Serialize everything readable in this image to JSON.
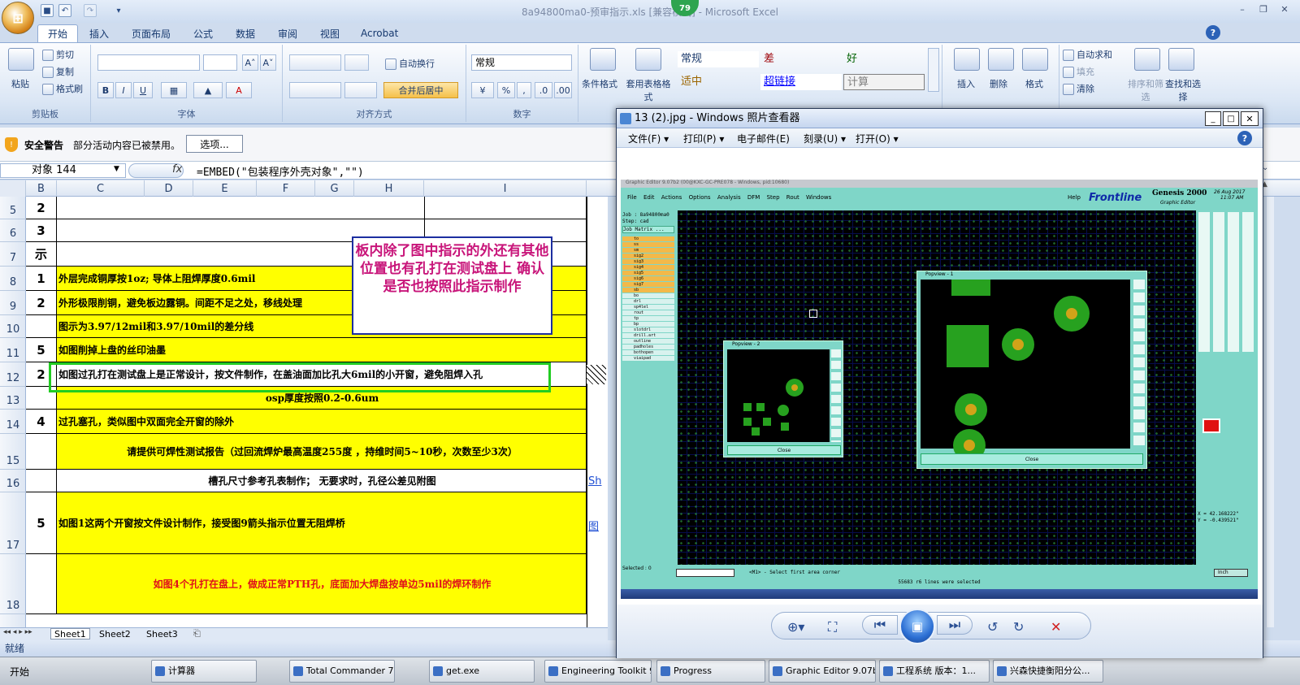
{
  "app": {
    "office_button": "⊞",
    "window_title": "8a94800ma0-预审指示.xls  [兼容模式] - Microsoft Excel",
    "badge": "79"
  },
  "ribbon": {
    "tabs": [
      "开始",
      "插入",
      "页面布局",
      "公式",
      "数据",
      "审阅",
      "视图",
      "Acrobat"
    ],
    "active_tab": "开始",
    "clipboard": {
      "paste": "粘贴",
      "cut": "剪切",
      "copy": "复制",
      "format_painter": "格式刷",
      "label": "剪贴板"
    },
    "font": {
      "label": "字体",
      "bold": "B",
      "italic": "I",
      "underline": "U",
      "grow": "A˄",
      "shrink": "A˅"
    },
    "alignment": {
      "label": "对齐方式",
      "wrap": "自动换行",
      "merge": "合并后居中"
    },
    "number": {
      "label": "数字",
      "format": "常规",
      "percent": "%",
      "comma": ","
    },
    "styles": {
      "conditional": "条件格式",
      "table_format": "套用表格格式",
      "normal": "常规",
      "bad": "差",
      "good": "好",
      "neutral": "适中",
      "hyperlink": "超链接",
      "calc": "计算"
    },
    "cells": {
      "insert": "插入",
      "delete": "删除",
      "format": "格式"
    },
    "editing": {
      "autosum": "自动求和",
      "fill": "填充",
      "clear": "清除",
      "sort": "排序和筛选",
      "find": "查找和选择"
    }
  },
  "security": {
    "title": "安全警告",
    "message": "部分活动内容已被禁用。",
    "options": "选项..."
  },
  "formula_bar": {
    "name_box": "对象 144",
    "fx": "fx",
    "formula": "=EMBED(\"包装程序外壳对象\",\"\")"
  },
  "columns": [
    "B",
    "C",
    "D",
    "E",
    "F",
    "G",
    "H",
    "I"
  ],
  "extra_column": "T",
  "rows": [
    {
      "row": "5",
      "num": "2",
      "text": "",
      "yellow": false
    },
    {
      "row": "6",
      "num": "3",
      "text": "",
      "yellow": false
    },
    {
      "row": "7",
      "num": "示",
      "text": "",
      "yellow": false
    },
    {
      "row": "8",
      "num": "1",
      "text": "外层完成铜厚按1oz;  导体上阻焊厚度0.6mil",
      "yellow": true
    },
    {
      "row": "9",
      "num": "2",
      "text": "外形极限削铜，避免板边露铜。间距不足之处，移线处理",
      "yellow": true
    },
    {
      "row": "10",
      "num": "",
      "text": "图示为3.97/12mil和3.97/10mil的差分线",
      "yellow": true
    },
    {
      "row": "11",
      "num": "5",
      "text": "如图削掉上盘的丝印油墨",
      "yellow": true
    },
    {
      "row": "12",
      "num": "2",
      "text": "如图过孔打在测试盘上是正常设计，按文件制作，在盖油面加比孔大6mil的小开窗，避免阻焊入孔",
      "yellow": false
    },
    {
      "row": "13",
      "num": "",
      "text": "osp厚度按照0.2-0.6um",
      "yellow": true
    },
    {
      "row": "14",
      "num": "4",
      "text": "过孔塞孔，类似图中双面完全开窗的除外",
      "yellow": true
    },
    {
      "row": "15",
      "num": "",
      "text": "请提供可焊性测试报告（过回流焊炉最高温度255度 ，持维时间5~10秒，次数至少3次）",
      "yellow": true
    },
    {
      "row": "16",
      "num": "",
      "text": "槽孔尺寸参考孔表制作；      无要求时，孔径公差见附图",
      "yellow": false
    },
    {
      "row": "17",
      "num": "5",
      "text": "如图1这两个开窗按文件设计制作，接受图9箭头指示位置无阻焊桥",
      "yellow": true
    },
    {
      "row": "18",
      "num": "",
      "text": "如图4个孔打在盘上，做成正常PTH孔，底面加大焊盘按单边5mil的焊环制作",
      "yellow": true
    }
  ],
  "note": "板内除了图中指示的外还有其他位置也有孔打在测试盘上  确认是否也按照此指示制作",
  "sheet_tabs": [
    "Sheet1",
    "Sheet2",
    "Sheet3"
  ],
  "status": "就绪",
  "side_fragments": {
    "sh": "Sh",
    "tu": "图"
  },
  "viewer": {
    "title": "13 (2).jpg - Windows 照片查看器",
    "menu": [
      "文件(F) ▾",
      "打印(P) ▾",
      "电子邮件(E)",
      "刻录(U) ▾",
      "打开(O) ▾"
    ],
    "help": "?",
    "genesis": {
      "titlebar": "Graphic Editor 9.07b2 (00@KXC-GC-PRE078 - Windows, pid:10680)",
      "menus": [
        "File",
        "Edit",
        "Actions",
        "Options",
        "Analysis",
        "DFM",
        "Step",
        "Rout",
        "Windows"
      ],
      "help": "Help",
      "brand": "Frontline",
      "product": "Genesis 2000",
      "product_sub": "Graphic Editor",
      "date": "26 Aug 2017",
      "time": "11:07 AM",
      "job": "Job : 8a94800ma0",
      "step": "Step: cad",
      "matrix": "Job Matrix ...",
      "layers": [
        "to",
        "ss",
        "sm",
        "sig2",
        "sig3",
        "sig4",
        "sig5",
        "sig6",
        "sig7",
        "sb",
        "bo",
        "drl",
        "sp4lel",
        "rout",
        "tp",
        "bp",
        "slotdrl",
        "drill.art",
        "outline",
        "padholes",
        "bothopen",
        "viaipad"
      ],
      "popview1": "Popview - 1",
      "popview2": "Popview - 2",
      "close": "Close",
      "selected": "Selected : 0",
      "prompt": "<M1> - Select first area corner",
      "message": "55683 r6 lines were selected",
      "coords_x": "X = 42.168222\"",
      "coords_y": "Y = -0.439521\"",
      "unit": "Inch"
    }
  },
  "taskbar": {
    "start": "开始",
    "items": [
      "计算器",
      "Total Commander 7....",
      "get.exe",
      "Engineering Toolkit 9...",
      "Progress",
      "Graphic Editor 9.07b...",
      "工程系统  版本：1...",
      "兴森快捷衡阳分公..."
    ]
  }
}
